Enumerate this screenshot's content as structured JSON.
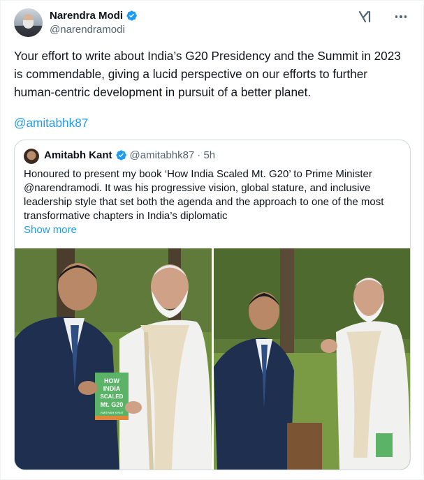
{
  "author": {
    "name": "Narendra Modi",
    "handle": "@narendramodi",
    "verified_color": "#1d9bf0"
  },
  "tweet": {
    "text": "Your effort to write about India’s G20 Presidency and the Summit in 2023 is commendable, giving a lucid perspective on our efforts to further human-centric development in pursuit of a better planet.",
    "mention": "@amitabhk87"
  },
  "quote": {
    "name": "Amitabh Kant",
    "handle": "@amitabhk87",
    "time": "· 5h",
    "text": "Honoured to present my book ‘How India Scaled Mt. G20’ to Prime Minister @narendramodi. It was his progressive vision, global stature, and inclusive leadership style that set both the agenda and the approach to one of the most transformative chapters in India’s diplomatic",
    "show_more": "Show more",
    "book_cover": {
      "line1": "HOW",
      "line2": "INDIA",
      "line3": "SCALED",
      "line4": "Mt. G20",
      "author": "AMITABH KANT"
    }
  },
  "icons": {
    "header_right": [
      "grok-icon",
      "more-options-icon"
    ]
  },
  "colors": {
    "link": "#1d9bf0",
    "secondary_text": "#536471",
    "border": "#cfd9de"
  }
}
